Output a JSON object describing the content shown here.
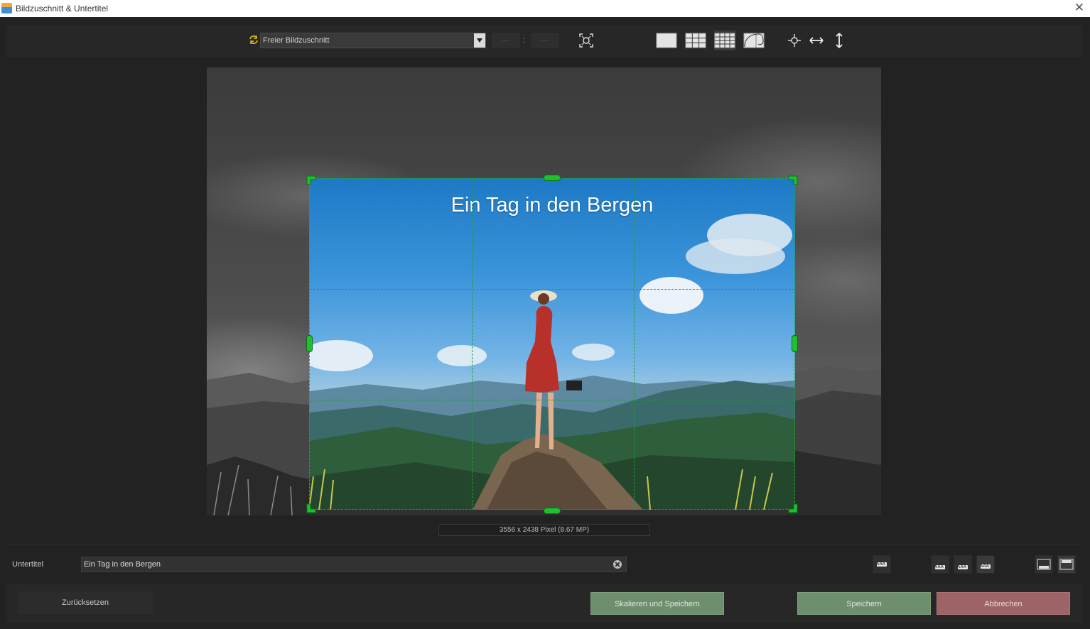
{
  "window": {
    "title": "Bildzuschnitt & Untertitel",
    "close_glyph": "✕"
  },
  "toolbar": {
    "crop_mode": "Freier Bildzuschnitt",
    "ratio_width": "----",
    "ratio_height": "----",
    "ratio_separator": ":",
    "icons": [
      "sync-icon",
      "center-focus-icon",
      "no-grid-icon",
      "grid-3x3-icon",
      "grid-4x4-icon",
      "golden-spiral-icon",
      "center-crosshair-icon",
      "flip-horizontal-icon",
      "flip-vertical-icon"
    ]
  },
  "preview": {
    "subtitle_overlay": "Ein Tag in den Bergen",
    "image_info": "3556 x 2438  Pixel  (8.67 MP)",
    "grid_color": "#1fa33a"
  },
  "subtitle": {
    "label": "Untertitel",
    "value": "Ein Tag in den Bergen",
    "position_icons": [
      "text-style-icon",
      "align-left-icon",
      "align-center-icon",
      "align-right-icon",
      "position-bottom-icon",
      "position-top-icon"
    ],
    "button_text": "AAA"
  },
  "buttons": {
    "reset": "Zurücksetzen",
    "scale_and_save": "Skalieren und Speichern",
    "save": "Speichern",
    "cancel": "Abbrechen"
  },
  "colors": {
    "save_green": "#6e8e6e",
    "cancel_red": "#9c6466",
    "handle_green": "#1fbf2f"
  }
}
